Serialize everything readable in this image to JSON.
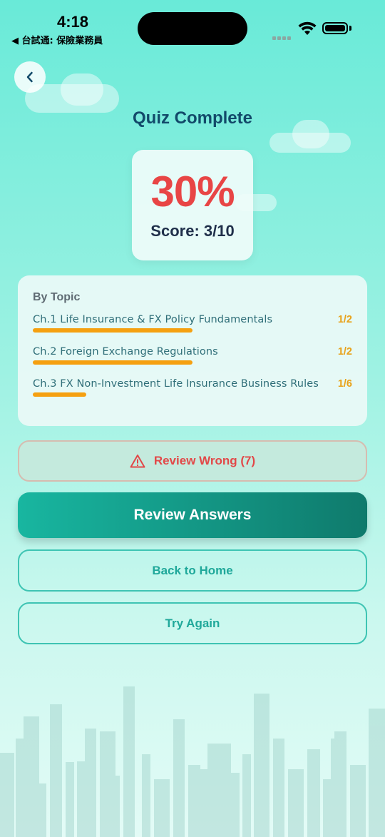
{
  "status_bar": {
    "time": "4:18",
    "back_app": "◀ 台試通: 保險業務員"
  },
  "header": {
    "title": "Quiz Complete"
  },
  "score": {
    "percent": "30%",
    "label": "Score: 3/10"
  },
  "topics": {
    "heading": "By Topic",
    "items": [
      {
        "name": "Ch.1 Life Insurance & FX Policy Fundamentals",
        "score": "1/2",
        "fraction": 0.5
      },
      {
        "name": "Ch.2 Foreign Exchange Regulations",
        "score": "1/2",
        "fraction": 0.5
      },
      {
        "name": "Ch.3 FX Non-Investment Life Insurance Business Rules",
        "score": "1/6",
        "fraction": 0.1667
      }
    ]
  },
  "buttons": {
    "review_wrong": "Review Wrong (7)",
    "review_answers": "Review Answers",
    "back_home": "Back to Home",
    "try_again": "Try Again"
  },
  "colors": {
    "accent": "#18b6a0",
    "danger": "#e84545",
    "warning": "#f5a010"
  }
}
